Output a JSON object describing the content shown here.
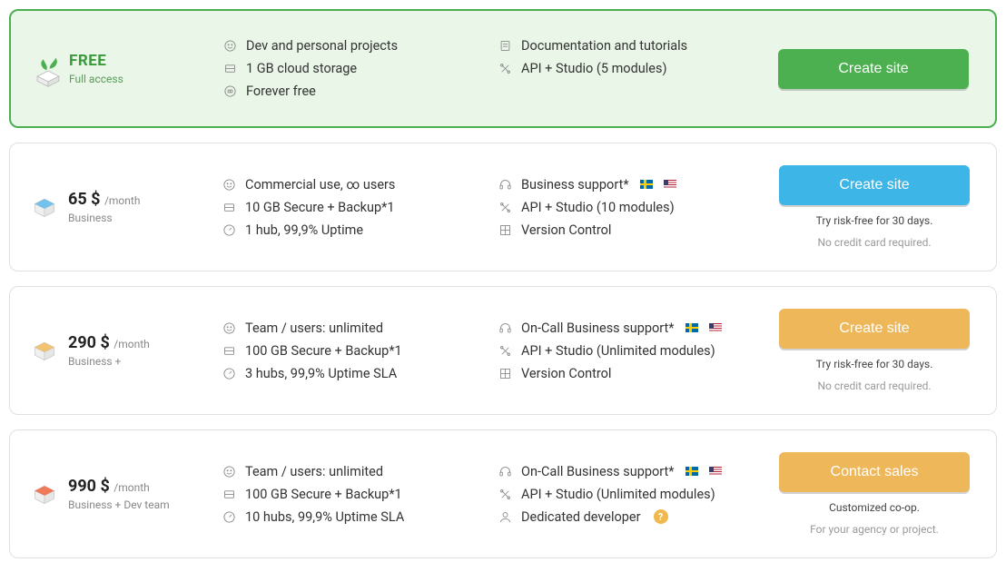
{
  "plans": [
    {
      "id": "free",
      "title": "FREE",
      "subtitle": "Full access",
      "features_left": [
        {
          "icon": "smile",
          "text": "Dev and personal projects"
        },
        {
          "icon": "storage",
          "text": "1 GB cloud storage"
        },
        {
          "icon": "infinity",
          "text": "Forever free"
        }
      ],
      "features_right": [
        {
          "icon": "doc",
          "text": "Documentation and tutorials"
        },
        {
          "icon": "tools",
          "text": "API + Studio (5 modules)"
        }
      ],
      "button": {
        "label": "Create site",
        "color": "green"
      },
      "note1": "",
      "note2": ""
    },
    {
      "id": "business",
      "price": "65 $",
      "unit": "/month",
      "subtitle": "Business",
      "box_color": "#5bb6ea",
      "features_left": [
        {
          "icon": "smile",
          "text": "Commercial use, ∞ users"
        },
        {
          "icon": "storage",
          "text": "10 GB Secure + Backup*1"
        },
        {
          "icon": "gauge",
          "text": "1 hub, 99,9% Uptime"
        }
      ],
      "features_right": [
        {
          "icon": "headset",
          "text": "Business support*",
          "flags": true
        },
        {
          "icon": "tools",
          "text": "API + Studio (10 modules)"
        },
        {
          "icon": "grid",
          "text": "Version Control"
        }
      ],
      "button": {
        "label": "Create site",
        "color": "blue"
      },
      "note1": "Try risk-free for 30 days.",
      "note2": "No credit card required."
    },
    {
      "id": "business-plus",
      "price": "290 $",
      "unit": "/month",
      "subtitle": "Business +",
      "box_color": "#eeb85a",
      "features_left": [
        {
          "icon": "smile",
          "text": "Team / users: unlimited"
        },
        {
          "icon": "storage",
          "text": "100 GB Secure + Backup*1"
        },
        {
          "icon": "gauge",
          "text": "3 hubs, 99,9% Uptime SLA"
        }
      ],
      "features_right": [
        {
          "icon": "headset",
          "text": "On-Call Business support*",
          "flags": true
        },
        {
          "icon": "tools",
          "text": "API + Studio (Unlimited modules)"
        },
        {
          "icon": "grid",
          "text": "Version Control"
        }
      ],
      "button": {
        "label": "Create site",
        "color": "orange"
      },
      "note1": "Try risk-free for 30 days.",
      "note2": "No credit card required."
    },
    {
      "id": "business-dev",
      "price": "990 $",
      "unit": "/month",
      "subtitle": "Business + Dev team",
      "box_color": "#f0623a",
      "features_left": [
        {
          "icon": "smile",
          "text": "Team / users: unlimited"
        },
        {
          "icon": "storage",
          "text": "100 GB Secure + Backup*1"
        },
        {
          "icon": "gauge",
          "text": "10 hubs, 99,9% Uptime SLA"
        }
      ],
      "features_right": [
        {
          "icon": "headset",
          "text": "On-Call Business support*",
          "flags": true
        },
        {
          "icon": "tools",
          "text": "API + Studio (Unlimited modules)"
        },
        {
          "icon": "person",
          "text": "Dedicated developer",
          "help": true
        }
      ],
      "button": {
        "label": "Contact sales",
        "color": "orange"
      },
      "note1": "Customized co-op.",
      "note2": "For your agency or project."
    }
  ]
}
